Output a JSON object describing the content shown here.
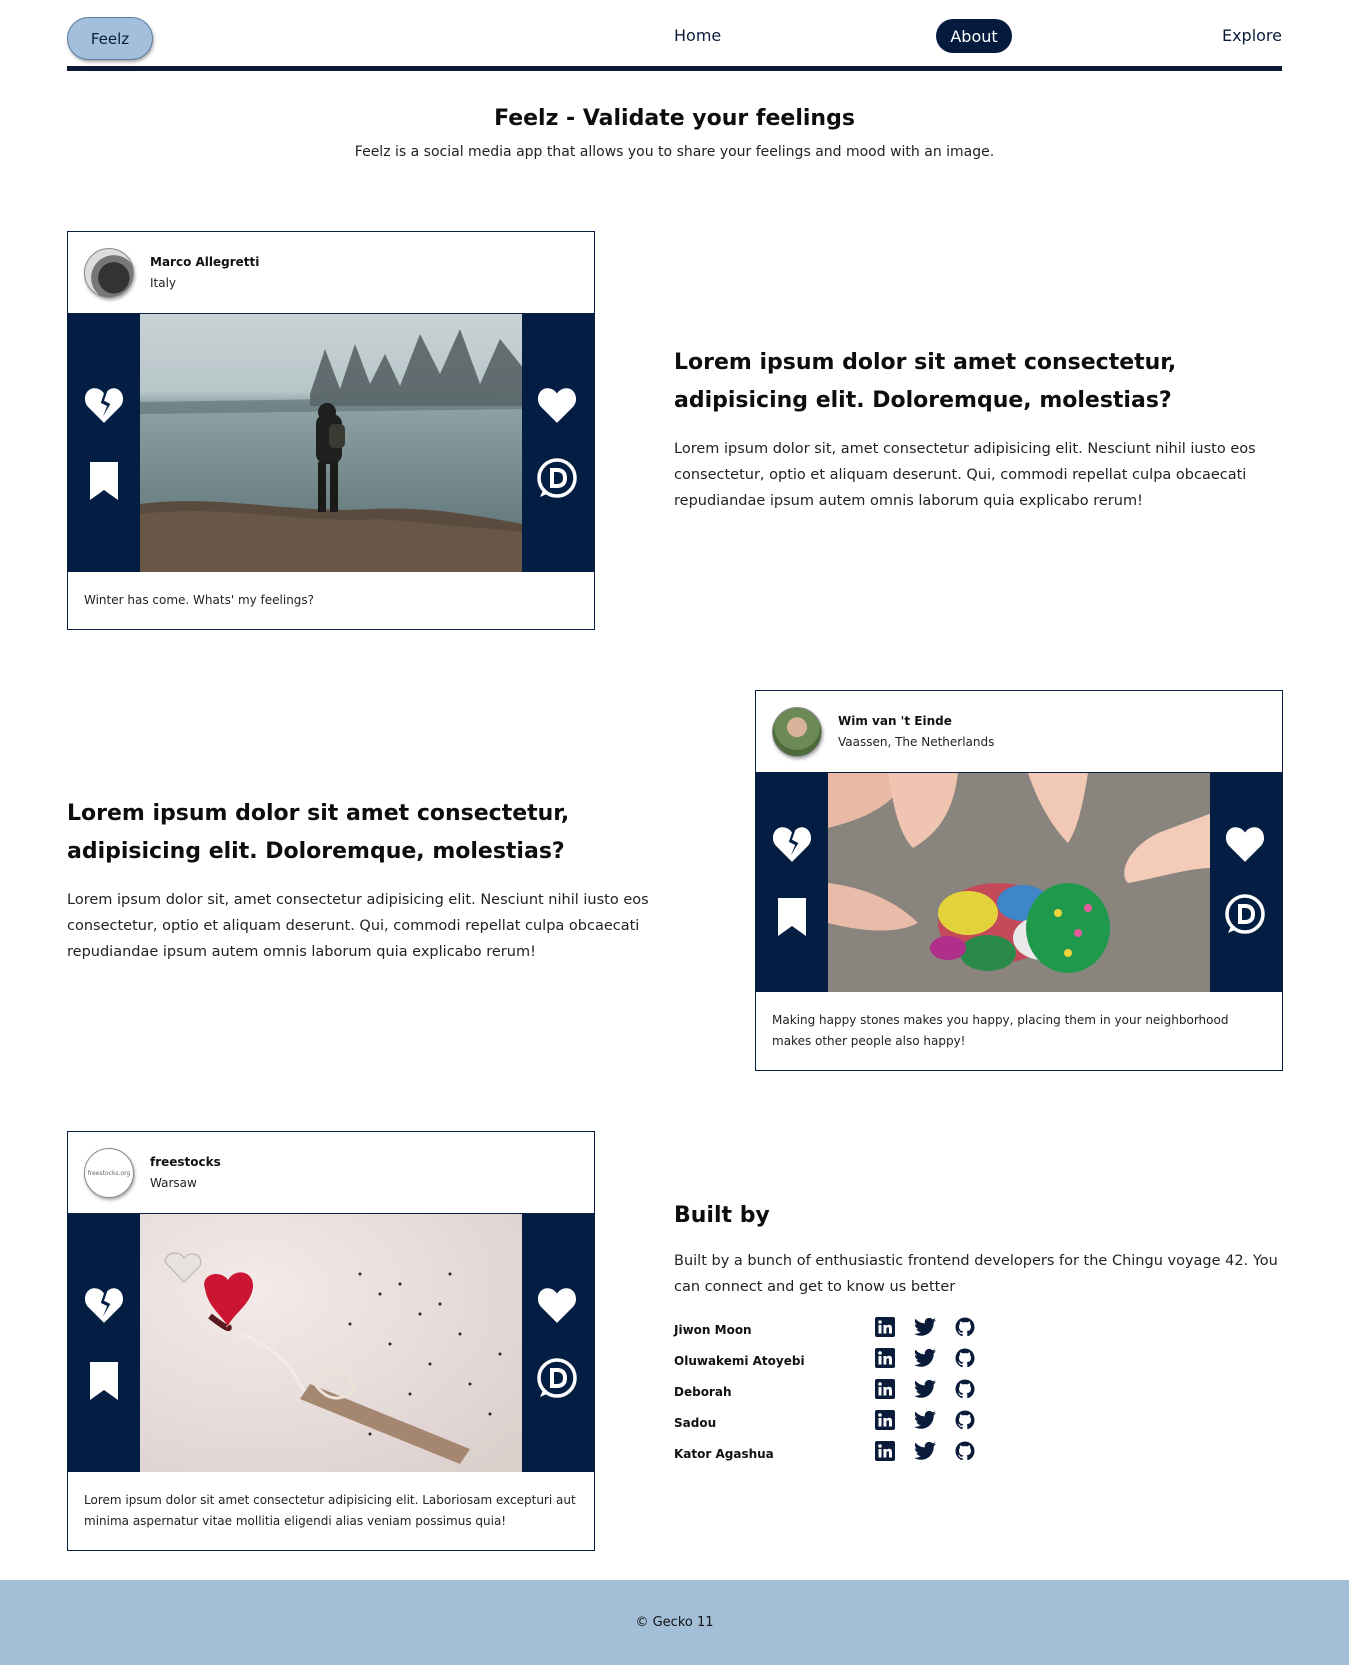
{
  "nav": {
    "logo_label": "Feelz",
    "links": [
      {
        "label": "Home"
      },
      {
        "label": "About"
      },
      {
        "label": "Explore"
      }
    ]
  },
  "hero": {
    "title": "Feelz - Validate your feelings",
    "subtitle": "Feelz is a social media app that allows you to share your feelings and mood with an image."
  },
  "posts": [
    {
      "user": "Marco Allegretti",
      "location": "Italy",
      "caption": "Winter has come. Whats' my feelings?"
    },
    {
      "user": "Wim van 't Einde",
      "location": "Vaassen, The Netherlands",
      "caption": "Making happy stones makes you happy, placing them in your neighborhood makes other people also happy!"
    },
    {
      "user": "freestocks",
      "location": "Warsaw",
      "avatar_text": "freestocks.org",
      "caption": "Lorem ipsum dolor sit amet consectetur adipisicing elit. Laboriosam excepturi aut minima aspernatur vitae mollitia eligendi alias veniam possimus quia!"
    }
  ],
  "blocks": [
    {
      "heading": "Lorem ipsum dolor sit amet consectetur, adipisicing elit. Doloremque, molestias?",
      "body": "Lorem ipsum dolor sit, amet consectetur adipisicing elit. Nesciunt nihil iusto eos consectetur, optio et aliquam deserunt. Qui, commodi repellat culpa obcaecati repudiandae ipsum autem omnis laborum quia explicabo rerum!"
    },
    {
      "heading": "Lorem ipsum dolor sit amet consectetur, adipisicing elit. Doloremque, molestias?",
      "body": "Lorem ipsum dolor sit, amet consectetur adipisicing elit. Nesciunt nihil iusto eos consectetur, optio et aliquam deserunt. Qui, commodi repellat culpa obcaecati repudiandae ipsum autem omnis laborum quia explicabo rerum!"
    }
  ],
  "built": {
    "title": "Built by",
    "text": "Built by a bunch of enthusiastic frontend developers for the Chingu voyage 42. You can connect and get to know us better",
    "members": [
      {
        "name": "Jiwon Moon"
      },
      {
        "name": "Oluwakemi Atoyebi"
      },
      {
        "name": "Deborah"
      },
      {
        "name": "Sadou"
      },
      {
        "name": "Kator Agashua"
      }
    ],
    "social_icons": [
      "linkedin-icon",
      "twitter-icon",
      "github-icon"
    ]
  },
  "footer": {
    "text": "© Gecko 11"
  },
  "colors": {
    "navy": "#041e43",
    "light_blue": "#a3bfdb"
  }
}
